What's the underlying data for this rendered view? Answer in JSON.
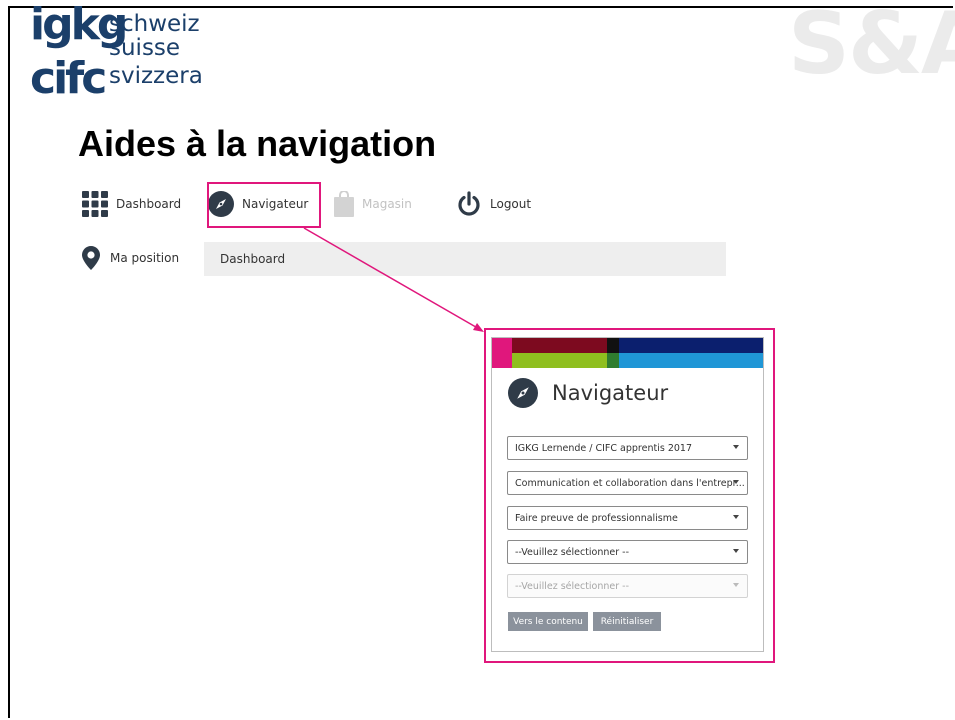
{
  "logo": {
    "big_top": "igkg",
    "big_bottom": "cifc",
    "lang1": "schweiz",
    "lang2": "suisse",
    "lang3": "svizzera"
  },
  "watermark": "S&A",
  "page_title": "Aides à la navigation",
  "nav": {
    "dashboard": "Dashboard",
    "navigator": "Navigateur",
    "shop": "Magasin",
    "logout": "Logout"
  },
  "position": {
    "label": "Ma position",
    "value": "Dashboard"
  },
  "navigator_panel": {
    "title": "Navigateur",
    "selects": [
      "IGKG Lernende / CIFC apprentis 2017",
      "Communication et collaboration dans l'entrepr...",
      "Faire preuve de professionnalisme",
      "--Veuillez sélectionner --",
      "--Veuillez sélectionner --"
    ],
    "button_content": "Vers le contenu",
    "button_reset": "Réinitialiser"
  },
  "colors": {
    "highlight": "#e0177c",
    "logo": "#1b3f6a",
    "icon_dark": "#2f3b48"
  }
}
